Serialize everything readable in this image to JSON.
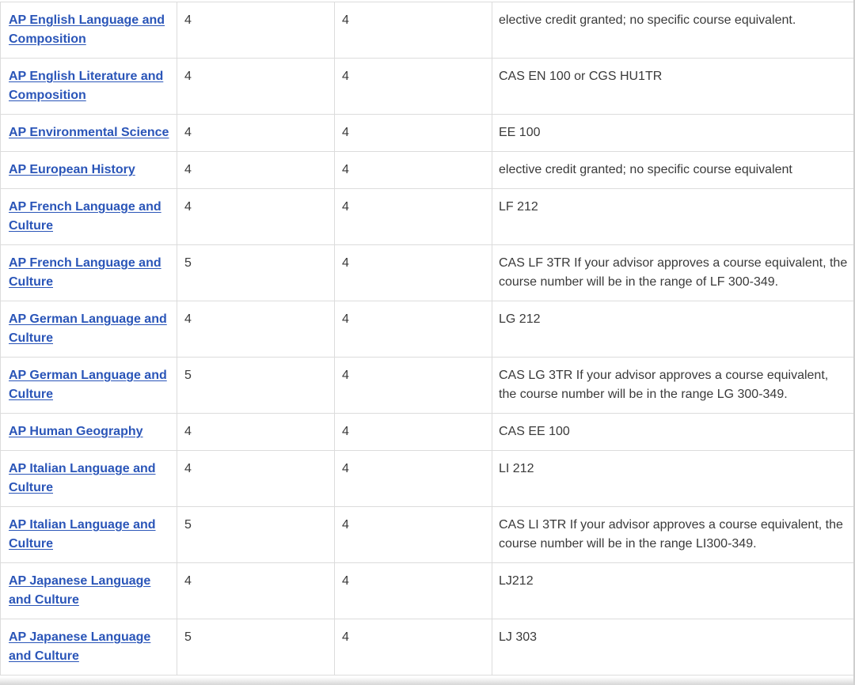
{
  "table": {
    "rows": [
      {
        "course": "AP English Language and Composition",
        "score": "4",
        "credits": "4",
        "equivalent": "elective credit granted; no specific course equivalent."
      },
      {
        "course": "AP English Literature and Composition",
        "score": "4",
        "credits": "4",
        "equivalent": "CAS EN 100 or CGS HU1TR"
      },
      {
        "course": "AP Environmental Science",
        "score": "4",
        "credits": "4",
        "equivalent": "EE 100"
      },
      {
        "course": "AP European History",
        "score": "4",
        "credits": "4",
        "equivalent": "elective credit granted; no specific course equivalent"
      },
      {
        "course": "AP French Language and Culture",
        "score": "4",
        "credits": "4",
        "equivalent": "LF 212"
      },
      {
        "course": "AP French Language and Culture",
        "score": "5",
        "credits": "4",
        "equivalent": "CAS LF 3TR If your advisor approves a course equivalent, the course number will be in the range of LF 300-349."
      },
      {
        "course": "AP German Language and Culture",
        "score": "4",
        "credits": "4",
        "equivalent": "LG 212"
      },
      {
        "course": "AP German Language and Culture",
        "score": "5",
        "credits": "4",
        "equivalent": "CAS LG 3TR If your advisor approves a course equivalent, the course number will be in the range LG 300-349."
      },
      {
        "course": "AP Human Geography",
        "score": "4",
        "credits": "4",
        "equivalent": "CAS EE 100"
      },
      {
        "course": "AP Italian Language and Culture",
        "score": "4",
        "credits": "4",
        "equivalent": "LI 212"
      },
      {
        "course": "AP Italian Language and Culture",
        "score": "5",
        "credits": "4",
        "equivalent": "CAS LI 3TR If your advisor approves a course equivalent, the course number will be in the range LI300-349."
      },
      {
        "course": "AP Japanese Language and Culture",
        "score": "4",
        "credits": "4",
        "equivalent": "LJ212"
      },
      {
        "course": "AP Japanese Language and Culture",
        "score": "5",
        "credits": "4",
        "equivalent": "LJ 303"
      }
    ]
  },
  "colors": {
    "link": "#2a55b8",
    "text": "#3a3a3a",
    "border": "#dcdcdc"
  }
}
